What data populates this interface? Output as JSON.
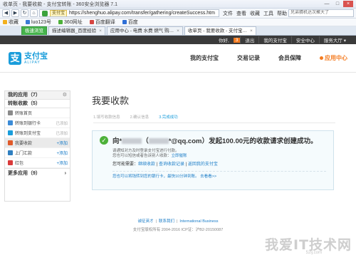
{
  "window": {
    "title": "收单页 - 我要收款 - 支付宝转账 - 360安全浏览器 7.1",
    "buttons": [
      "—",
      "□",
      "×"
    ]
  },
  "address": {
    "trust": "支付宝",
    "url": "https://shenghuo.alipay.com/transfer/gathering/createSuccess.htm",
    "menu": [
      "文件",
      "查看",
      "收藏",
      "工具",
      "帮助"
    ],
    "search_placeholder": "兄弟猜机达次聚大了"
  },
  "bookmarks": [
    {
      "label": "收藏",
      "color": "#f2b01e"
    },
    {
      "label": "luo123号",
      "color": "#3a7bd5"
    },
    {
      "label": "360网址",
      "color": "#4db13a"
    },
    {
      "label": "百度翻译",
      "color": "#d64541"
    },
    {
      "label": "百度",
      "color": "#2f6fd6"
    }
  ],
  "tabs": [
    {
      "label": "极速浏览",
      "style": "green"
    },
    {
      "label": "描述编辑器_百度经验",
      "style": ""
    },
    {
      "label": "应用中心 - 电费 水费 燃气 购…",
      "style": ""
    },
    {
      "label": "收单页 - 我要收款 - 支付宝…",
      "style": "active"
    }
  ],
  "topnav": {
    "greeting": "你好,",
    "count": "3",
    "links": [
      "退出",
      "我的支付宝",
      "安全中心",
      "服务大厅 ▾"
    ]
  },
  "header": {
    "logo_cn": "支付宝",
    "logo_en": "ALIPAY",
    "nav": [
      "我的支付宝",
      "交易记录",
      "会员保障"
    ],
    "nav_hot": "应用中心"
  },
  "sidebar": {
    "my_apps": "我的应用（7）",
    "transfer": "转账收款（5）",
    "items": [
      {
        "label": "转账首页",
        "action": "",
        "color": "#8a8a8a",
        "active": false
      },
      {
        "label": "转账到银行卡",
        "action": "已添加",
        "color": "#3b8bd6",
        "active": false
      },
      {
        "label": "转账到支付宝",
        "action": "已添加",
        "color": "#1a9ddb",
        "active": false
      },
      {
        "label": "我要收款",
        "action": "+添加",
        "color": "#e05a2a",
        "active": true
      },
      {
        "label": "上门汇款",
        "action": "+添加",
        "color": "#2f7fc0",
        "active": false
      },
      {
        "label": "红包",
        "action": "+添加",
        "color": "#d93a3a",
        "active": false
      }
    ],
    "more": "更多应用（9）",
    "more_arrow": "›"
  },
  "main": {
    "title": "我要收款",
    "steps": [
      "1.填写收款信息",
      "2.确认信息",
      "3.完成成功"
    ],
    "result": {
      "title_prefix": "向*",
      "title_mid": "（",
      "title_suffix": "*@qq.com）发起100.00元的收款请求创建成功。",
      "line1": "请通知对方及时登录支付宝进行付款。",
      "line2_pre": "您也可以短信或者告诉别人收款：",
      "line2_link": "立即催账",
      "prompt": "您可能需要：",
      "link_continue": "继续收款",
      "sep1": " | ",
      "link_query": "查询收款记录",
      "sep2": " | ",
      "link_back": "返回我的支付宝",
      "tip_link": "您也可以将钱转到您的银行卡，最快10分钟到账。",
      "tip_go": "去看看>>"
    }
  },
  "footer": {
    "links": [
      "诚征英才",
      "联系我们",
      "International Business"
    ],
    "copyright": "支付宝版权所有 2004-2016 ICP证：沪B2-20150087"
  },
  "watermark": {
    "main": "我爱IT技术网",
    "sub": "52ij.com"
  }
}
